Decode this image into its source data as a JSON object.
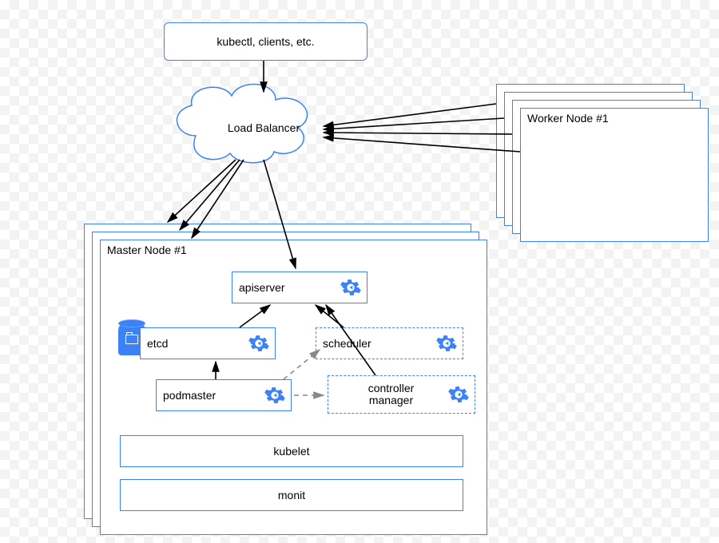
{
  "clients": {
    "label": "kubectl, clients, etc."
  },
  "load_balancer": {
    "label": "Load Balancer"
  },
  "worker_stack": {
    "title": "Worker Node #1"
  },
  "master_stack": {
    "title": "Master Node #1",
    "services": {
      "apiserver": "apiserver",
      "etcd": "etcd",
      "podmaster": "podmaster",
      "scheduler": "scheduler",
      "controller_manager": "controller\nmanager"
    },
    "kubelet": "kubelet",
    "monit": "monit"
  }
}
